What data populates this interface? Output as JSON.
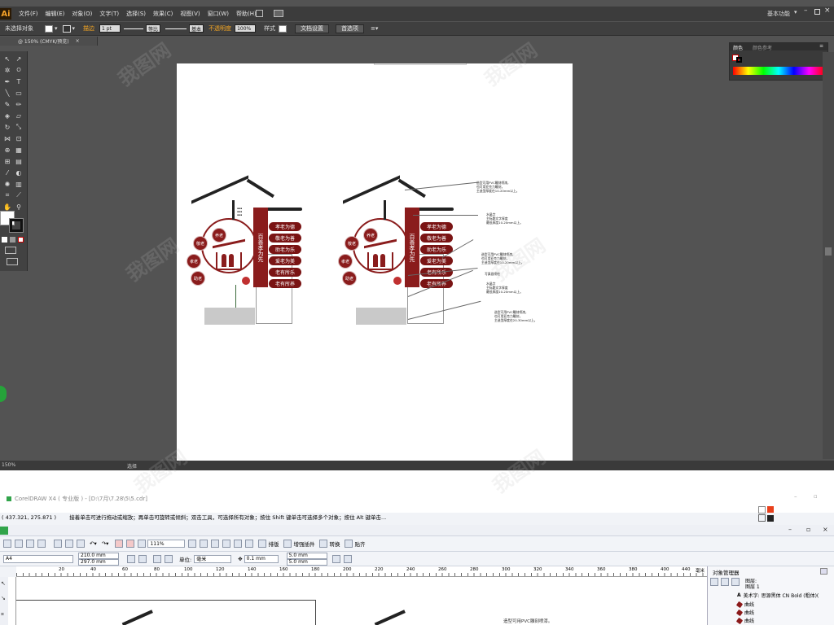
{
  "illustrator": {
    "logo": "Ai",
    "menus": [
      "文件(F)",
      "编辑(E)",
      "对象(O)",
      "文字(T)",
      "选择(S)",
      "效果(C)",
      "视图(V)",
      "窗口(W)",
      "帮助(H)"
    ],
    "workspace": "基本功能",
    "control_bar": {
      "selection": "未选择对象",
      "stroke_label": "描边",
      "stroke_weight": "1 pt",
      "stroke_profile": "等比",
      "brush": "基本",
      "opacity_label": "不透明度",
      "opacity_value": "100%",
      "style_label": "样式",
      "doc_settings": "文档设置",
      "preferences": "首选项"
    },
    "doc_tab": "@ 150% (CMYK/预览)",
    "doc_tab_close": "×",
    "color_panel": {
      "tab_color": "颜色",
      "tab_ref": "颜色参考"
    },
    "status": {
      "zoom": "150%",
      "mode": "选择"
    },
    "ime_bar": "英"
  },
  "artwork": {
    "pills": [
      "孝老为德",
      "敬老为善",
      "助老为乐",
      "爱老为美",
      "老有所乐",
      "老有所养"
    ],
    "circles": [
      "养老",
      "敬老",
      "孝老",
      "助老"
    ],
    "big_circle": "养老",
    "vertical_banner": "百善孝为先",
    "notes": [
      [
        "造型可用PVC雕刻喷漆，",
        "也可用亚克力雕刻，",
        "主造型厚度在10-20mm以上。"
      ],
      [
        "水晶字",
        "主标题文字厚度",
        "最低厚度10-20mm以上。"
      ],
      [
        "造型可用PVC雕刻喷漆，",
        "也可用亚克力雕刻，",
        "主造型厚度在10-20mm以上。"
      ],
      [
        "写真画喷绘"
      ],
      [
        "水晶字",
        "主标题文字厚度",
        "最低厚度10-20mm以上。"
      ],
      [
        "造型可用PVC雕刻喷漆，",
        "也可用亚克力雕刻，",
        "主造型厚度在20-30mm以上。"
      ]
    ]
  },
  "coreldraw": {
    "title": "CorelDRAW X4 ( 专业版 ) - [D:\\7月\\7.28\\5\\5.cdr]",
    "coords": "( 437.321, 275.871 )",
    "hint": "接着单击可进行拖动或缩放；再单击可旋转或倾斜；双击工具，可选择所有对象；按住 Shift 键单击可选择多个对象；按住 Alt 键单击...",
    "zoom": "111%",
    "toolbar_labels": [
      "排版",
      "增强插件",
      "转换",
      "贴齐"
    ],
    "page_size": "A4",
    "width": "210.0 mm",
    "height": "297.0 mm",
    "units_label": "单位:",
    "units_value": "毫米",
    "nudge": "0.1 mm",
    "dup_x": "5.0 mm",
    "dup_y": "5.0 mm",
    "ruler_ticks": [
      "20",
      "40",
      "60",
      "80",
      "100",
      "120",
      "140",
      "160",
      "180",
      "200",
      "220",
      "240",
      "260",
      "280",
      "300",
      "320",
      "340",
      "360",
      "380",
      "400",
      "420",
      "440"
    ],
    "ruler_unit": "毫米",
    "canvas_note": "造型可用PVC雕刻喷漆。",
    "object_manager": {
      "title": "对象管理器",
      "layers": [
        "图层:",
        "图层 1"
      ],
      "items": [
        "美术字: 思源黑体 CN Bold (粗体)(",
        "曲线",
        "曲线",
        "曲线"
      ]
    }
  },
  "watermark": "我图网"
}
